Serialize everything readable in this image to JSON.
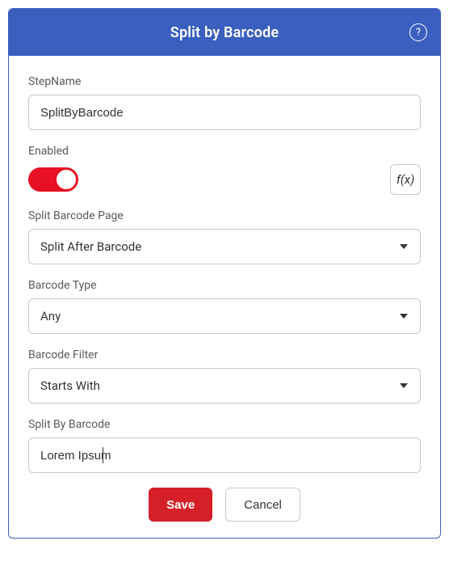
{
  "header": {
    "title": "Split by Barcode",
    "help_icon_label": "?"
  },
  "fields": {
    "stepName": {
      "label": "StepName",
      "value": "SplitByBarcode"
    },
    "enabled": {
      "label": "Enabled",
      "on": true,
      "fx_label": "f(x)"
    },
    "splitBarcodePage": {
      "label": "Split Barcode Page",
      "value": "Split After Barcode"
    },
    "barcodeType": {
      "label": "Barcode Type",
      "value": "Any"
    },
    "barcodeFilter": {
      "label": "Barcode Filter",
      "value": "Starts With"
    },
    "splitByBarcode": {
      "label": "Split By Barcode",
      "value": "Lorem Ipsum"
    }
  },
  "footer": {
    "save": "Save",
    "cancel": "Cancel"
  }
}
